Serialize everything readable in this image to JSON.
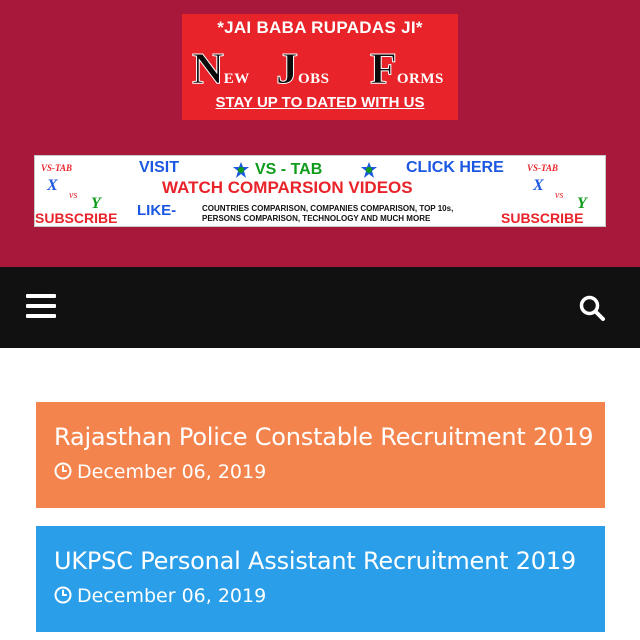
{
  "header": {
    "logo": {
      "top_line": "*JAI BABA RUPADAS JI*",
      "words": [
        {
          "initial": "N",
          "rest": "EW"
        },
        {
          "initial": "J",
          "rest": "OBS"
        },
        {
          "initial": "F",
          "rest": "ORMS"
        }
      ],
      "tagline": "STAY UP TO DATED WITH US"
    },
    "banner": {
      "visit": "VISIT",
      "brand": "VS - TAB",
      "click": "CLICK HERE",
      "headline": "WATCH COMPARSION VIDEOS",
      "like": "LIKE-",
      "desc_line1": "COUNTRIES COMPARISON, COMPANIES COMPARISON, TOP 10s,",
      "desc_line2": "PERSONS COMPARISON, TECHNOLOGY AND MUCH MORE",
      "subscribe": "SUBSCRIBE",
      "corner_brand": "VS-TAB"
    },
    "colors": {
      "header_bg": "#a8183b",
      "logo_bg": "#e8232a"
    }
  },
  "nav": {
    "menu_icon": "hamburger-menu-icon",
    "search_icon": "search-icon",
    "bg": "#111111"
  },
  "posts": [
    {
      "title": "Rajasthan Police Constable Recruitment 2019",
      "date": "December 06, 2019",
      "color": "#f4844e"
    },
    {
      "title": "UKPSC Personal Assistant Recruitment 2019",
      "date": "December 06, 2019",
      "color": "#2b9ee9"
    }
  ]
}
